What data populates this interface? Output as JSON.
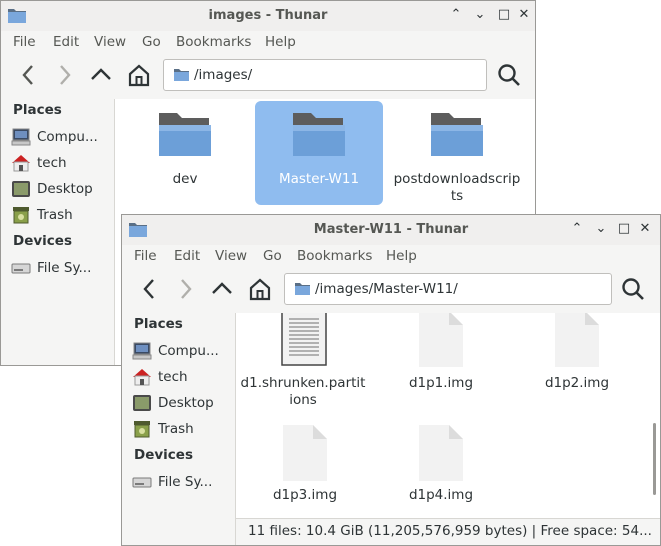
{
  "back_window": {
    "title": "images - Thunar",
    "menu": [
      "File",
      "Edit",
      "View",
      "Go",
      "Bookmarks",
      "Help"
    ],
    "location": "/images/",
    "places_header": "Places",
    "places": [
      "Compu...",
      "tech",
      "Desktop",
      "Trash"
    ],
    "devices_header": "Devices",
    "devices": [
      "File Sy..."
    ],
    "files": [
      {
        "name": "dev",
        "selected": false
      },
      {
        "name": "Master-W11",
        "selected": true
      },
      {
        "name": "postdownloadscripts",
        "selected": false
      }
    ]
  },
  "front_window": {
    "title": "Master-W11 - Thunar",
    "menu": [
      "File",
      "Edit",
      "View",
      "Go",
      "Bookmarks",
      "Help"
    ],
    "location": "/images/Master-W11/",
    "places_header": "Places",
    "places": [
      "Compu...",
      "tech",
      "Desktop",
      "Trash"
    ],
    "devices_header": "Devices",
    "devices": [
      "File Sy..."
    ],
    "files": [
      {
        "name": "d1.shrunken.partitions",
        "type": "text"
      },
      {
        "name": "d1p1.img",
        "type": "file"
      },
      {
        "name": "d1p2.img",
        "type": "file"
      },
      {
        "name": "d1p3.img",
        "type": "file"
      },
      {
        "name": "d1p4.img",
        "type": "file"
      }
    ],
    "status": "11 files: 10.4 GiB (11,205,576,959 bytes)  |  Free space: 54..."
  },
  "icons": {
    "folder": "folder-icon",
    "computer": "computer-icon",
    "home": "home-folder-icon",
    "desktop": "desktop-icon",
    "trash": "trash-icon",
    "drive": "drive-icon"
  },
  "colors": {
    "selection": "#8fbcef",
    "folder_blue": "#6c9fd8",
    "folder_gray": "#6e6e6e"
  }
}
